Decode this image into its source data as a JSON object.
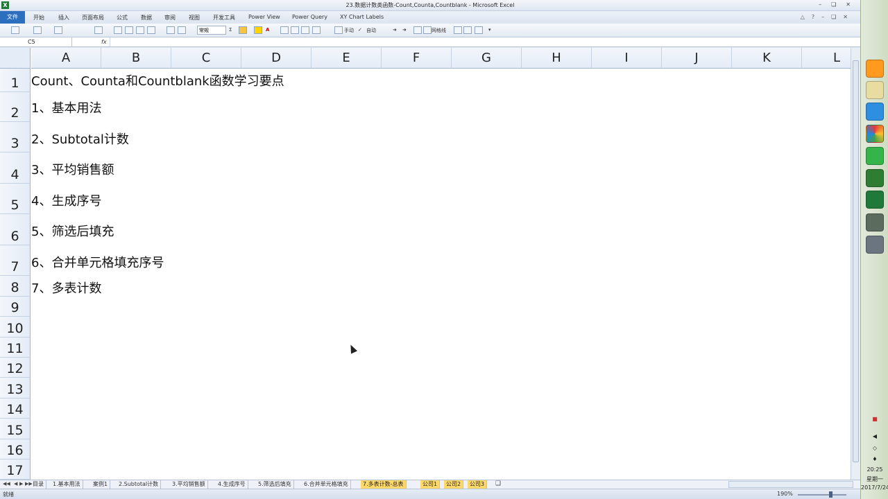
{
  "window": {
    "title": "23.数据计数类函数-Count,Counta,Countblank - Microsoft Excel"
  },
  "ribbon_tabs": [
    "文件",
    "开始",
    "插入",
    "页面布局",
    "公式",
    "数据",
    "审阅",
    "视图",
    "开发工具",
    "Power View",
    "Power Query",
    "XY Chart Labels"
  ],
  "toolbar": {
    "number_format": "常规",
    "wrap_text": "网格线",
    "auto_label": "手动",
    "auto_label2": "自动"
  },
  "formula_bar": {
    "name_box": "C5",
    "fx": "fx",
    "content": ""
  },
  "columns": [
    "A",
    "B",
    "C",
    "D",
    "E",
    "F",
    "G",
    "H",
    "I",
    "J",
    "K",
    "L"
  ],
  "rows": [
    "1",
    "2",
    "3",
    "4",
    "5",
    "6",
    "7",
    "8",
    "9",
    "10",
    "11",
    "12",
    "13",
    "14",
    "15",
    "16",
    "17"
  ],
  "cells": {
    "A1": "Count、Counta和Countblank函数学习要点",
    "A2": "1、基本用法",
    "A3": "2、Subtotal计数",
    "A4": "3、平均销售额",
    "A5": "4、生成序号",
    "A6": "5、筛选后填充",
    "A7": "6、合并单元格填充序号",
    "A8": "7、多表计数"
  },
  "sheet_tabs": [
    {
      "label": "目录",
      "active": false
    },
    {
      "label": "1.基本用法",
      "active": false
    },
    {
      "label": "案例1",
      "active": false
    },
    {
      "label": "2.Subtotal计数",
      "active": false
    },
    {
      "label": "3.平均销售额",
      "active": false
    },
    {
      "label": "4.生成序号",
      "active": false
    },
    {
      "label": "5.筛选后填充",
      "active": false
    },
    {
      "label": "6.合并单元格填充",
      "active": false
    },
    {
      "label": "7.多表计数-总表",
      "active": true
    },
    {
      "label": "公司1",
      "active": true
    },
    {
      "label": "公司2",
      "active": true
    },
    {
      "label": "公司3",
      "active": true
    }
  ],
  "status": {
    "ready": "就绪",
    "zoom": "190%"
  },
  "taskbar": {
    "time": "20:25",
    "weekday": "星期一",
    "date": "2017/7/24"
  },
  "colors": {
    "active_tab": "#ffd86b",
    "file_tab": "#2d6fbf",
    "header_bg": "#e4ecf7"
  }
}
